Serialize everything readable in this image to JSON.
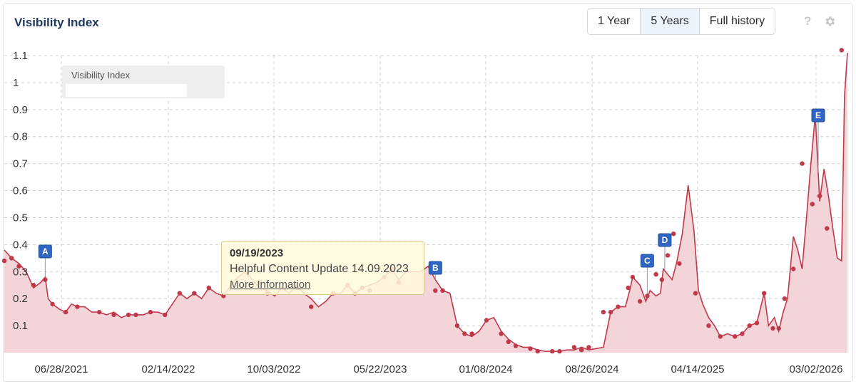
{
  "header": {
    "title": "Visibility Index",
    "range_buttons": [
      "1 Year",
      "5 Years",
      "Full history"
    ],
    "active_range": "5 Years",
    "help_icon": "?"
  },
  "legend": {
    "label": "Visibility Index"
  },
  "tooltip": {
    "date": "09/19/2023",
    "text": "Helpful Content Update 14.09.2023",
    "link": "More Information"
  },
  "colors": {
    "line": "#c0394b",
    "fill": "#f3d4d9",
    "marker": "#2f65c3"
  },
  "chart_data": {
    "type": "area",
    "ylim": [
      0,
      1.1
    ],
    "yticks": [
      0.1,
      0.2,
      0.3,
      0.4,
      0.5,
      0.6,
      0.7,
      0.8,
      0.9,
      1,
      1.1
    ],
    "xticks": [
      "06/28/2021",
      "02/14/2022",
      "10/03/2022",
      "05/22/2023",
      "01/08/2024",
      "08/26/2024",
      "04/14/2025",
      "03/02/2026"
    ],
    "grid": true,
    "series": [
      {
        "values": [
          [
            0.0,
            0.38
          ],
          [
            0.5,
            0.35
          ],
          [
            1.0,
            0.33
          ],
          [
            1.5,
            0.3
          ],
          [
            2.0,
            0.24
          ],
          [
            2.5,
            0.26
          ],
          [
            2.8,
            0.28
          ],
          [
            3.0,
            0.2
          ],
          [
            3.3,
            0.18
          ],
          [
            3.8,
            0.16
          ],
          [
            4.2,
            0.15
          ],
          [
            4.6,
            0.18
          ],
          [
            5.0,
            0.17
          ],
          [
            5.5,
            0.17
          ],
          [
            6.0,
            0.15
          ],
          [
            6.5,
            0.15
          ],
          [
            7.0,
            0.14
          ],
          [
            7.5,
            0.15
          ],
          [
            8.0,
            0.13
          ],
          [
            8.5,
            0.14
          ],
          [
            9.0,
            0.14
          ],
          [
            9.5,
            0.14
          ],
          [
            10.0,
            0.15
          ],
          [
            10.5,
            0.15
          ],
          [
            11.0,
            0.14
          ],
          [
            11.5,
            0.18
          ],
          [
            12.0,
            0.22
          ],
          [
            12.5,
            0.2
          ],
          [
            13.0,
            0.22
          ],
          [
            13.5,
            0.2
          ],
          [
            14.0,
            0.24
          ],
          [
            14.5,
            0.22
          ],
          [
            15.0,
            0.21
          ],
          [
            15.5,
            0.25
          ],
          [
            16.0,
            0.28
          ],
          [
            16.5,
            0.3
          ],
          [
            17.0,
            0.27
          ],
          [
            17.5,
            0.24
          ],
          [
            18.0,
            0.23
          ],
          [
            18.5,
            0.21
          ],
          [
            19.0,
            0.24
          ],
          [
            19.5,
            0.22
          ],
          [
            20.0,
            0.25
          ],
          [
            20.5,
            0.22
          ],
          [
            21.0,
            0.2
          ],
          [
            21.5,
            0.17
          ],
          [
            22.0,
            0.19
          ],
          [
            22.5,
            0.22
          ],
          [
            23.0,
            0.22
          ],
          [
            23.5,
            0.25
          ],
          [
            24.0,
            0.22
          ],
          [
            24.5,
            0.24
          ],
          [
            25.0,
            0.25
          ],
          [
            25.5,
            0.26
          ],
          [
            26.0,
            0.28
          ],
          [
            26.5,
            0.31
          ],
          [
            27.0,
            0.27
          ],
          [
            27.5,
            0.3
          ],
          [
            28.0,
            0.3
          ],
          [
            28.5,
            0.3
          ],
          [
            29.0,
            0.32
          ],
          [
            29.5,
            0.27
          ],
          [
            30.0,
            0.23
          ],
          [
            30.5,
            0.22
          ],
          [
            31.0,
            0.1
          ],
          [
            31.5,
            0.07
          ],
          [
            32.0,
            0.06
          ],
          [
            32.5,
            0.08
          ],
          [
            33.0,
            0.12
          ],
          [
            33.5,
            0.13
          ],
          [
            34.0,
            0.08
          ],
          [
            34.5,
            0.05
          ],
          [
            35.0,
            0.03
          ],
          [
            35.5,
            0.02
          ],
          [
            36.0,
            0.02
          ],
          [
            36.5,
            0.01
          ],
          [
            37.0,
            0.005
          ],
          [
            37.5,
            0.005
          ],
          [
            38.0,
            0.005
          ],
          [
            38.5,
            0.01
          ],
          [
            39.0,
            0.01
          ],
          [
            39.5,
            0.02
          ],
          [
            40.0,
            0.01
          ],
          [
            40.5,
            0.015
          ],
          [
            41.0,
            0.02
          ],
          [
            41.5,
            0.15
          ],
          [
            42.0,
            0.17
          ],
          [
            42.5,
            0.17
          ],
          [
            42.8,
            0.23
          ],
          [
            43.0,
            0.28
          ],
          [
            43.5,
            0.25
          ],
          [
            43.9,
            0.19
          ],
          [
            44.2,
            0.23
          ],
          [
            44.6,
            0.21
          ],
          [
            44.9,
            0.22
          ],
          [
            45.1,
            0.31
          ],
          [
            45.4,
            0.29
          ],
          [
            45.7,
            0.27
          ],
          [
            46.0,
            0.33
          ],
          [
            46.4,
            0.44
          ],
          [
            46.8,
            0.62
          ],
          [
            47.2,
            0.45
          ],
          [
            47.5,
            0.23
          ],
          [
            47.8,
            0.18
          ],
          [
            48.2,
            0.13
          ],
          [
            48.6,
            0.1
          ],
          [
            49.0,
            0.06
          ],
          [
            49.5,
            0.07
          ],
          [
            50.0,
            0.06
          ],
          [
            50.5,
            0.07
          ],
          [
            51.0,
            0.1
          ],
          [
            51.5,
            0.11
          ],
          [
            52.0,
            0.22
          ],
          [
            52.3,
            0.1
          ],
          [
            52.7,
            0.13
          ],
          [
            53.0,
            0.08
          ],
          [
            53.3,
            0.15
          ],
          [
            53.6,
            0.2
          ],
          [
            54.0,
            0.43
          ],
          [
            54.3,
            0.38
          ],
          [
            54.6,
            0.31
          ],
          [
            54.9,
            0.5
          ],
          [
            55.2,
            0.7
          ],
          [
            55.5,
            0.88
          ],
          [
            55.8,
            0.56
          ],
          [
            56.1,
            0.68
          ],
          [
            56.4,
            0.58
          ],
          [
            56.7,
            0.46
          ],
          [
            57.0,
            0.35
          ],
          [
            57.3,
            0.34
          ],
          [
            57.5,
            0.95
          ],
          [
            57.7,
            1.11
          ]
        ],
        "points": [
          [
            0.0,
            0.34
          ],
          [
            0.5,
            0.35
          ],
          [
            1.0,
            0.32
          ],
          [
            2.0,
            0.25
          ],
          [
            2.8,
            0.27
          ],
          [
            3.3,
            0.18
          ],
          [
            4.2,
            0.15
          ],
          [
            5.0,
            0.17
          ],
          [
            6.5,
            0.15
          ],
          [
            7.5,
            0.14
          ],
          [
            8.5,
            0.14
          ],
          [
            9.0,
            0.14
          ],
          [
            10.0,
            0.15
          ],
          [
            11.0,
            0.14
          ],
          [
            12.0,
            0.22
          ],
          [
            13.0,
            0.22
          ],
          [
            14.0,
            0.24
          ],
          [
            15.0,
            0.21
          ],
          [
            17.5,
            0.26
          ],
          [
            18.0,
            0.22
          ],
          [
            21.0,
            0.17
          ],
          [
            22.5,
            0.22
          ],
          [
            23.5,
            0.25
          ],
          [
            24.0,
            0.22
          ],
          [
            24.5,
            0.24
          ],
          [
            25.0,
            0.23
          ],
          [
            26.0,
            0.28
          ],
          [
            26.5,
            0.31
          ],
          [
            27.0,
            0.26
          ],
          [
            29.5,
            0.23
          ],
          [
            30.0,
            0.23
          ],
          [
            31.0,
            0.1
          ],
          [
            31.5,
            0.07
          ],
          [
            32.0,
            0.07
          ],
          [
            33.0,
            0.12
          ],
          [
            34.0,
            0.07
          ],
          [
            34.5,
            0.04
          ],
          [
            35.0,
            0.025
          ],
          [
            36.0,
            0.015
          ],
          [
            36.5,
            0.005
          ],
          [
            37.5,
            0.005
          ],
          [
            38.0,
            0.005
          ],
          [
            39.0,
            0.02
          ],
          [
            39.5,
            0.01
          ],
          [
            40.0,
            0.02
          ],
          [
            41.0,
            0.15
          ],
          [
            41.5,
            0.15
          ],
          [
            42.0,
            0.17
          ],
          [
            42.7,
            0.24
          ],
          [
            43.0,
            0.28
          ],
          [
            43.5,
            0.19
          ],
          [
            44.0,
            0.21
          ],
          [
            44.6,
            0.29
          ],
          [
            45.0,
            0.27
          ],
          [
            45.4,
            0.36
          ],
          [
            45.8,
            0.44
          ],
          [
            46.2,
            0.33
          ],
          [
            47.3,
            0.22
          ],
          [
            48.2,
            0.1
          ],
          [
            49.0,
            0.06
          ],
          [
            50.0,
            0.06
          ],
          [
            50.5,
            0.07
          ],
          [
            51.0,
            0.1
          ],
          [
            51.5,
            0.11
          ],
          [
            52.0,
            0.22
          ],
          [
            52.6,
            0.09
          ],
          [
            53.0,
            0.09
          ],
          [
            53.4,
            0.2
          ],
          [
            54.0,
            0.31
          ],
          [
            54.6,
            0.7
          ],
          [
            55.3,
            0.55
          ],
          [
            55.8,
            0.58
          ],
          [
            56.3,
            0.46
          ],
          [
            57.3,
            1.12
          ]
        ]
      }
    ],
    "event_markers": [
      {
        "label": "A",
        "x": 2.8
      },
      {
        "label": "B",
        "x": 29.5
      },
      {
        "label": "C",
        "x": 44.0
      },
      {
        "label": "D",
        "x": 45.2
      },
      {
        "label": "E",
        "x": 55.7
      }
    ]
  }
}
